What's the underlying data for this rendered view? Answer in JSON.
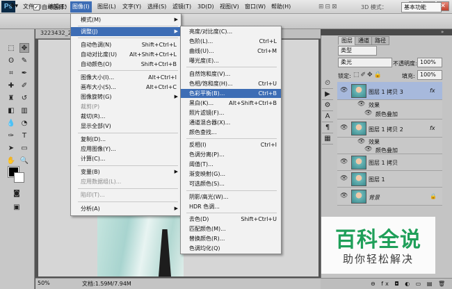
{
  "app": {
    "logo": "Ps"
  },
  "menubar": {
    "items": [
      "文件(F)",
      "编辑(E)",
      "图像(I)",
      "图层(L)",
      "文字(Y)",
      "选择(S)",
      "滤镜(T)",
      "3D(D)",
      "视图(V)",
      "窗口(W)",
      "帮助(H)"
    ],
    "window_buttons": {
      "minimize": "−",
      "restore": "□",
      "close": "✕"
    }
  },
  "options": {
    "auto_select_label": "自动选择：",
    "checkbox_mark": "✓",
    "mode_3d": "3D 模式：",
    "workspace": "基本功能"
  },
  "document": {
    "tab_label": "3223432_2",
    "zoom": "50%",
    "doc_size": "文档:1.59M/7.94M"
  },
  "image_menu": {
    "items": [
      {
        "label": "模式(M)",
        "shortcut": "",
        "submenu": true,
        "state": "normal"
      },
      {
        "label": "调整(J)",
        "shortcut": "",
        "submenu": true,
        "state": "highlight"
      },
      {
        "label": "自动色调(N)",
        "shortcut": "Shift+Ctrl+L",
        "state": "normal"
      },
      {
        "label": "自动对比度(U)",
        "shortcut": "Alt+Shift+Ctrl+L",
        "state": "normal"
      },
      {
        "label": "自动颜色(O)",
        "shortcut": "Shift+Ctrl+B",
        "state": "normal"
      },
      {
        "label": "图像大小(I)...",
        "shortcut": "Alt+Ctrl+I",
        "state": "normal"
      },
      {
        "label": "画布大小(S)...",
        "shortcut": "Alt+Ctrl+C",
        "state": "normal"
      },
      {
        "label": "图像旋转(G)",
        "shortcut": "",
        "submenu": true,
        "state": "normal"
      },
      {
        "label": "裁剪(P)",
        "shortcut": "",
        "state": "disabled"
      },
      {
        "label": "裁切(R)...",
        "shortcut": "",
        "state": "normal"
      },
      {
        "label": "显示全部(V)",
        "shortcut": "",
        "state": "normal"
      },
      {
        "label": "复制(D)...",
        "shortcut": "",
        "state": "normal"
      },
      {
        "label": "应用图像(Y)...",
        "shortcut": "",
        "state": "normal"
      },
      {
        "label": "计算(C)...",
        "shortcut": "",
        "state": "normal"
      },
      {
        "label": "变量(B)",
        "shortcut": "",
        "submenu": true,
        "state": "normal"
      },
      {
        "label": "应用数据组(L)...",
        "shortcut": "",
        "state": "disabled"
      },
      {
        "label": "陷印(T)...",
        "shortcut": "",
        "state": "disabled"
      },
      {
        "label": "分析(A)",
        "shortcut": "",
        "submenu": true,
        "state": "normal"
      }
    ]
  },
  "adjust_menu": {
    "items": [
      {
        "label": "亮度/对比度(C)...",
        "shortcut": "",
        "state": "normal"
      },
      {
        "label": "色阶(L)...",
        "shortcut": "Ctrl+L",
        "state": "normal"
      },
      {
        "label": "曲线(U)...",
        "shortcut": "Ctrl+M",
        "state": "normal"
      },
      {
        "label": "曝光度(E)...",
        "shortcut": "",
        "state": "normal"
      },
      {
        "label": "自然饱和度(V)...",
        "shortcut": "",
        "state": "normal"
      },
      {
        "label": "色相/饱和度(H)...",
        "shortcut": "Ctrl+U",
        "state": "normal"
      },
      {
        "label": "色彩平衡(B)...",
        "shortcut": "Ctrl+B",
        "state": "highlight"
      },
      {
        "label": "黑白(K)...",
        "shortcut": "Alt+Shift+Ctrl+B",
        "state": "normal"
      },
      {
        "label": "照片滤镜(F)...",
        "shortcut": "",
        "state": "normal"
      },
      {
        "label": "通道混合器(X)...",
        "shortcut": "",
        "state": "normal"
      },
      {
        "label": "颜色查找...",
        "shortcut": "",
        "state": "normal"
      },
      {
        "label": "反相(I)",
        "shortcut": "Ctrl+I",
        "state": "normal"
      },
      {
        "label": "色调分离(P)...",
        "shortcut": "",
        "state": "normal"
      },
      {
        "label": "阈值(T)...",
        "shortcut": "",
        "state": "normal"
      },
      {
        "label": "渐变映射(G)...",
        "shortcut": "",
        "state": "normal"
      },
      {
        "label": "可选颜色(S)...",
        "shortcut": "",
        "state": "normal"
      },
      {
        "label": "阴影/高光(W)...",
        "shortcut": "",
        "state": "normal"
      },
      {
        "label": "HDR 色调...",
        "shortcut": "",
        "state": "normal"
      },
      {
        "label": "去色(D)",
        "shortcut": "Shift+Ctrl+U",
        "state": "normal"
      },
      {
        "label": "匹配颜色(M)...",
        "shortcut": "",
        "state": "normal"
      },
      {
        "label": "替换颜色(R)...",
        "shortcut": "",
        "state": "normal"
      },
      {
        "label": "色调均化(Q)",
        "shortcut": "",
        "state": "normal"
      }
    ]
  },
  "layers_panel": {
    "tabs": [
      "图层",
      "通道",
      "路径"
    ],
    "filter_kind": "类型",
    "blend_mode": "柔光",
    "opacity_label": "不透明度:",
    "opacity_value": "100%",
    "lock_label": "锁定:",
    "fill_label": "填充:",
    "fill_value": "100%",
    "eye_glyph": "👁",
    "fx_glyph": "fx",
    "lock_glyph": "🔒",
    "effects_label": "效果",
    "color_overlay_label": "颜色叠加",
    "layers": [
      {
        "name": "图层 1 拷贝 3",
        "fx": true,
        "selected": true,
        "effects": true
      },
      {
        "name": "图层 1 拷贝 2",
        "fx": true,
        "selected": false,
        "effects": true
      },
      {
        "name": "图层 1 拷贝",
        "fx": false,
        "selected": false,
        "effects": false
      },
      {
        "name": "图层 1",
        "fx": false,
        "selected": false,
        "effects": false
      },
      {
        "name": "背景",
        "fx": false,
        "selected": false,
        "effects": false,
        "locked": true
      }
    ],
    "bottom_tools": "⊖  fx  ◘  ◐  ▭  ▤  🗑"
  },
  "watermark": {
    "title": "百科全说",
    "subtitle": "助你轻松解决"
  }
}
